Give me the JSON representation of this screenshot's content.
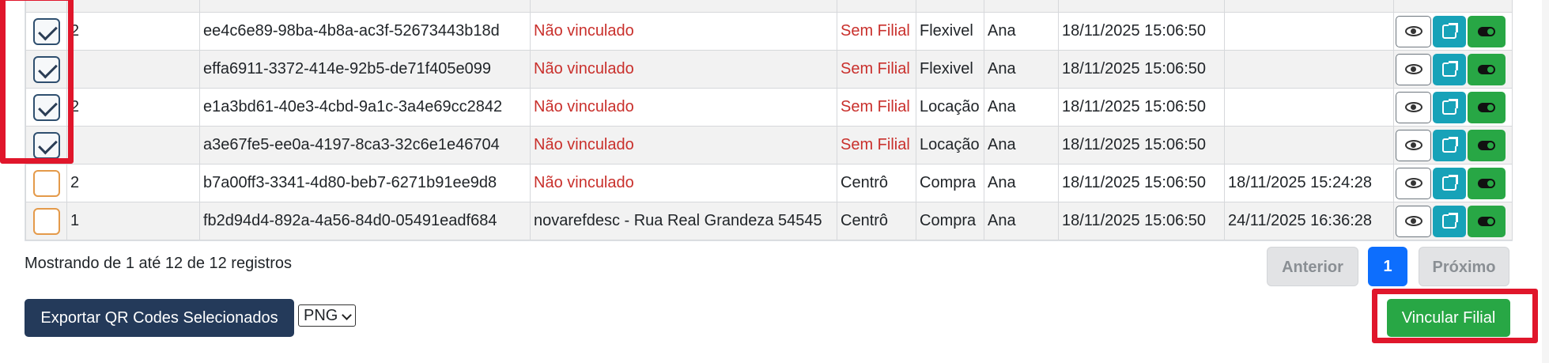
{
  "rows": [
    {
      "checked": true,
      "num": "2",
      "uuid": "ee4c6e89-98ba-4b8a-ac3f-52673443b18d",
      "local": "Não vinculado",
      "local_red": true,
      "filial": "Sem Filial",
      "filial_red": true,
      "tipo": "Flexivel",
      "user": "Ana",
      "created": "18/11/2025 15:06:50",
      "updated": ""
    },
    {
      "checked": true,
      "num": "",
      "uuid": "effa6911-3372-414e-92b5-de71f405e099",
      "local": "Não vinculado",
      "local_red": true,
      "filial": "Sem Filial",
      "filial_red": true,
      "tipo": "Flexivel",
      "user": "Ana",
      "created": "18/11/2025 15:06:50",
      "updated": ""
    },
    {
      "checked": true,
      "num": "2",
      "uuid": "e1a3bd61-40e3-4cbd-9a1c-3a4e69cc2842",
      "local": "Não vinculado",
      "local_red": true,
      "filial": "Sem Filial",
      "filial_red": true,
      "tipo": "Locação",
      "user": "Ana",
      "created": "18/11/2025 15:06:50",
      "updated": ""
    },
    {
      "checked": true,
      "num": "",
      "uuid": "a3e67fe5-ee0a-4197-8ca3-32c6e1e46704",
      "local": "Não vinculado",
      "local_red": true,
      "filial": "Sem Filial",
      "filial_red": true,
      "tipo": "Locação",
      "user": "Ana",
      "created": "18/11/2025 15:06:50",
      "updated": ""
    },
    {
      "checked": false,
      "num": "2",
      "uuid": "b7a00ff3-3341-4d80-beb7-6271b91ee9d8",
      "local": "Não vinculado",
      "local_red": true,
      "filial": "Centrô",
      "filial_red": false,
      "tipo": "Compra",
      "user": "Ana",
      "created": "18/11/2025 15:06:50",
      "updated": "18/11/2025 15:24:28"
    },
    {
      "checked": false,
      "num": "1",
      "uuid": "fb2d94d4-892a-4a56-84d0-05491eadf684",
      "local": "novarefdesc - Rua Real Grandeza 54545",
      "local_red": false,
      "filial": "Centrô",
      "filial_red": false,
      "tipo": "Compra",
      "user": "Ana",
      "created": "18/11/2025 15:06:50",
      "updated": "24/11/2025 16:36:28"
    }
  ],
  "icons": {
    "view": "eye-icon",
    "open": "external-link-icon",
    "toggle": "toggle-icon"
  },
  "footer": {
    "info": "Mostrando de 1 até 12 de 12 registros",
    "prev_label": "Anterior",
    "page_label": "1",
    "next_label": "Próximo"
  },
  "actions": {
    "export_label": "Exportar QR Codes Selecionados",
    "format_value": "PNG",
    "vincular_label": "Vincular Filial"
  },
  "colors": {
    "highlight": "#e0162b",
    "red_text": "#c9302c",
    "primary": "#0d6efd",
    "success": "#28a745",
    "info": "#17a2b8",
    "dark": "#243a5a"
  }
}
